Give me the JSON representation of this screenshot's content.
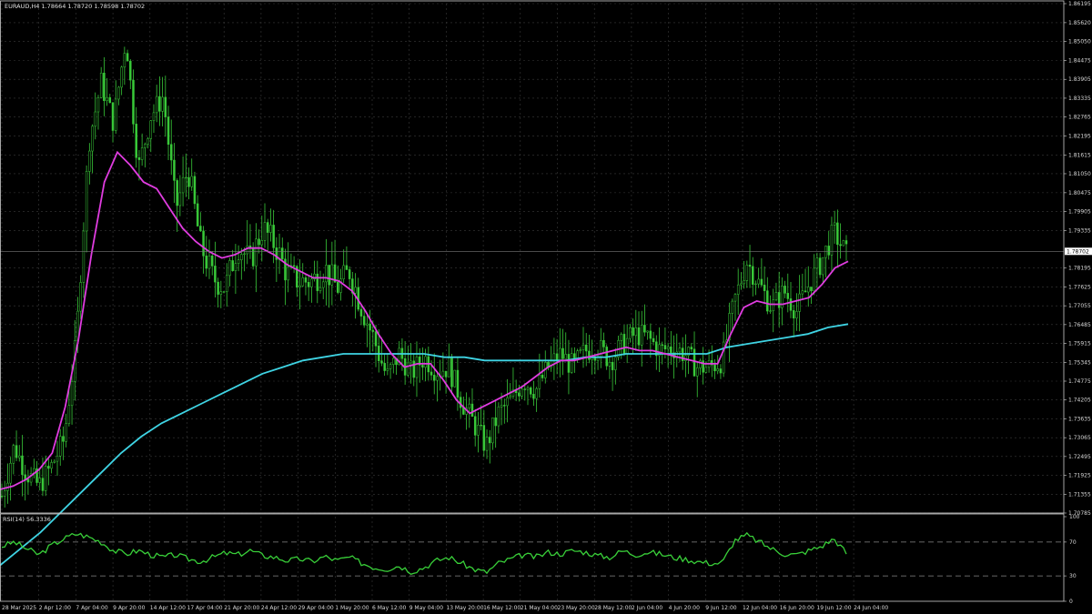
{
  "window": {
    "symbol_info": "EURAUD,H4  1.78664 1.78720 1.78598 1.78702"
  },
  "colors": {
    "background": "#000000",
    "grid": "#3a3a3a",
    "candle": "#39c939",
    "ma_fast": "#e03ce0",
    "ma_slow": "#3fd4e4",
    "rsi_line": "#39d039",
    "axis_text": "#d8d8d8",
    "price_tag_bg": "#ffffff",
    "price_tag_text": "#000000"
  },
  "chart_data": [
    {
      "type": "candlestick",
      "title": "EURAUD,H4",
      "ohlc_readout": {
        "open": 1.78664,
        "high": 1.7872,
        "low": 1.78598,
        "close": 1.78702
      },
      "ylim": [
        1.70785,
        1.86195
      ],
      "y_ticks": [
        "1.86195",
        "1.85620",
        "1.85050",
        "1.84475",
        "1.83905",
        "1.83335",
        "1.82765",
        "1.82195",
        "1.81615",
        "1.81050",
        "1.80475",
        "1.79905",
        "1.79335",
        "1.78702",
        "1.78195",
        "1.77625",
        "1.77055",
        "1.76485",
        "1.75915",
        "1.75345",
        "1.74775",
        "1.74205",
        "1.73635",
        "1.73065",
        "1.72495",
        "1.71925",
        "1.71355",
        "1.70785"
      ],
      "current_price": "1.78702",
      "x_ticks": [
        "28 Mar 2025",
        "2 Apr 12:00",
        "7 Apr 04:00",
        "9 Apr 20:00",
        "14 Apr 12:00",
        "17 Apr 04:00",
        "21 Apr 20:00",
        "24 Apr 12:00",
        "29 Apr 04:00",
        "1 May 20:00",
        "6 May 12:00",
        "9 May 04:00",
        "13 May 20:00",
        "16 May 12:00",
        "21 May 04:00",
        "23 May 20:00",
        "28 May 12:00",
        "2 Jun 04:00",
        "4 Jun 20:00",
        "9 Jun 12:00",
        "12 Jun 04:00",
        "16 Jun 20:00",
        "19 Jun 12:00",
        "24 Jun 04:00"
      ],
      "price_path": [
        1.713,
        1.728,
        1.72,
        1.716,
        1.722,
        1.73,
        1.76,
        1.82,
        1.838,
        1.826,
        1.852,
        1.812,
        1.828,
        1.834,
        1.8,
        1.812,
        1.789,
        1.779,
        1.776,
        1.789,
        1.784,
        1.794,
        1.789,
        1.78,
        1.778,
        1.778,
        1.782,
        1.776,
        1.781,
        1.77,
        1.76,
        1.749,
        1.756,
        1.75,
        1.755,
        1.751,
        1.752,
        1.742,
        1.735,
        1.728,
        1.738,
        1.742,
        1.748,
        1.745,
        1.752,
        1.756,
        1.752,
        1.757,
        1.758,
        1.754,
        1.759,
        1.762,
        1.761,
        1.757,
        1.758,
        1.756,
        1.752,
        1.752,
        1.754,
        1.772,
        1.784,
        1.777,
        1.77,
        1.775,
        1.769,
        1.777,
        1.784,
        1.793,
        1.786
      ],
      "series": [
        {
          "values": [
            1.715,
            1.716,
            1.718,
            1.721,
            1.726,
            1.74,
            1.76,
            1.786,
            1.808,
            1.817,
            1.813,
            1.808,
            1.806,
            1.8,
            1.794,
            1.79,
            1.787,
            1.785,
            1.786,
            1.788,
            1.788,
            1.786,
            1.783,
            1.781,
            1.779,
            1.779,
            1.778,
            1.775,
            1.769,
            1.762,
            1.756,
            1.752,
            1.753,
            1.753,
            1.748,
            1.742,
            1.738,
            1.74,
            1.742,
            1.744,
            1.746,
            1.749,
            1.752,
            1.754,
            1.754,
            1.755,
            1.756,
            1.757,
            1.758,
            1.757,
            1.757,
            1.756,
            1.755,
            1.754,
            1.753,
            1.753,
            1.762,
            1.77,
            1.772,
            1.771,
            1.771,
            1.772,
            1.773,
            1.777,
            1.782,
            1.784
          ]
        },
        {
          "values": [
            1.692,
            1.697,
            1.702,
            1.708,
            1.714,
            1.72,
            1.726,
            1.731,
            1.735,
            1.738,
            1.741,
            1.744,
            1.747,
            1.75,
            1.752,
            1.754,
            1.755,
            1.756,
            1.756,
            1.756,
            1.756,
            1.756,
            1.755,
            1.755,
            1.754,
            1.754,
            1.754,
            1.754,
            1.754,
            1.755,
            1.755,
            1.756,
            1.756,
            1.756,
            1.756,
            1.756,
            1.758,
            1.759,
            1.76,
            1.761,
            1.762,
            1.764,
            1.765
          ]
        }
      ]
    },
    {
      "type": "line",
      "title": "RSI(14) 56.3336",
      "ylim": [
        0,
        100
      ],
      "y_ticks": [
        "100",
        "70",
        "30",
        "0"
      ],
      "levels": [
        70,
        30
      ],
      "values": [
        65,
        70,
        62,
        55,
        66,
        74,
        80,
        76,
        70,
        60,
        56,
        60,
        55,
        52,
        55,
        50,
        47,
        52,
        57,
        55,
        60,
        54,
        52,
        48,
        50,
        47,
        53,
        48,
        52,
        45,
        40,
        38,
        42,
        35,
        40,
        48,
        52,
        45,
        38,
        34,
        45,
        50,
        55,
        52,
        58,
        56,
        60,
        58,
        54,
        52,
        60,
        55,
        58,
        56,
        52,
        50,
        47,
        45,
        45,
        72,
        78,
        70,
        62,
        56,
        55,
        60,
        65,
        74,
        57
      ]
    }
  ]
}
